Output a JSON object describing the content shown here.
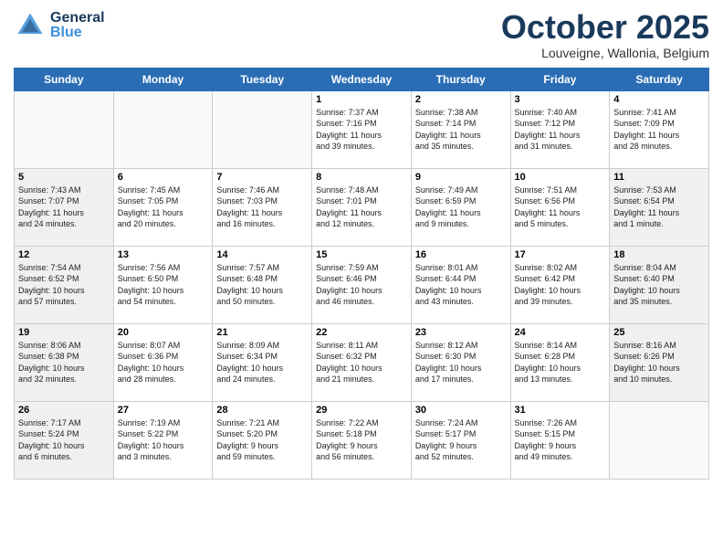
{
  "header": {
    "logo_general": "General",
    "logo_blue": "Blue",
    "month_title": "October 2025",
    "location": "Louveigne, Wallonia, Belgium"
  },
  "weekdays": [
    "Sunday",
    "Monday",
    "Tuesday",
    "Wednesday",
    "Thursday",
    "Friday",
    "Saturday"
  ],
  "weeks": [
    [
      {
        "day": "",
        "info": "",
        "empty": true
      },
      {
        "day": "",
        "info": "",
        "empty": true
      },
      {
        "day": "",
        "info": "",
        "empty": true
      },
      {
        "day": "1",
        "info": "Sunrise: 7:37 AM\nSunset: 7:16 PM\nDaylight: 11 hours\nand 39 minutes."
      },
      {
        "day": "2",
        "info": "Sunrise: 7:38 AM\nSunset: 7:14 PM\nDaylight: 11 hours\nand 35 minutes."
      },
      {
        "day": "3",
        "info": "Sunrise: 7:40 AM\nSunset: 7:12 PM\nDaylight: 11 hours\nand 31 minutes."
      },
      {
        "day": "4",
        "info": "Sunrise: 7:41 AM\nSunset: 7:09 PM\nDaylight: 11 hours\nand 28 minutes."
      }
    ],
    [
      {
        "day": "5",
        "info": "Sunrise: 7:43 AM\nSunset: 7:07 PM\nDaylight: 11 hours\nand 24 minutes.",
        "shaded": true
      },
      {
        "day": "6",
        "info": "Sunrise: 7:45 AM\nSunset: 7:05 PM\nDaylight: 11 hours\nand 20 minutes."
      },
      {
        "day": "7",
        "info": "Sunrise: 7:46 AM\nSunset: 7:03 PM\nDaylight: 11 hours\nand 16 minutes."
      },
      {
        "day": "8",
        "info": "Sunrise: 7:48 AM\nSunset: 7:01 PM\nDaylight: 11 hours\nand 12 minutes."
      },
      {
        "day": "9",
        "info": "Sunrise: 7:49 AM\nSunset: 6:59 PM\nDaylight: 11 hours\nand 9 minutes."
      },
      {
        "day": "10",
        "info": "Sunrise: 7:51 AM\nSunset: 6:56 PM\nDaylight: 11 hours\nand 5 minutes."
      },
      {
        "day": "11",
        "info": "Sunrise: 7:53 AM\nSunset: 6:54 PM\nDaylight: 11 hours\nand 1 minute.",
        "shaded": true
      }
    ],
    [
      {
        "day": "12",
        "info": "Sunrise: 7:54 AM\nSunset: 6:52 PM\nDaylight: 10 hours\nand 57 minutes.",
        "shaded": true
      },
      {
        "day": "13",
        "info": "Sunrise: 7:56 AM\nSunset: 6:50 PM\nDaylight: 10 hours\nand 54 minutes."
      },
      {
        "day": "14",
        "info": "Sunrise: 7:57 AM\nSunset: 6:48 PM\nDaylight: 10 hours\nand 50 minutes."
      },
      {
        "day": "15",
        "info": "Sunrise: 7:59 AM\nSunset: 6:46 PM\nDaylight: 10 hours\nand 46 minutes."
      },
      {
        "day": "16",
        "info": "Sunrise: 8:01 AM\nSunset: 6:44 PM\nDaylight: 10 hours\nand 43 minutes."
      },
      {
        "day": "17",
        "info": "Sunrise: 8:02 AM\nSunset: 6:42 PM\nDaylight: 10 hours\nand 39 minutes."
      },
      {
        "day": "18",
        "info": "Sunrise: 8:04 AM\nSunset: 6:40 PM\nDaylight: 10 hours\nand 35 minutes.",
        "shaded": true
      }
    ],
    [
      {
        "day": "19",
        "info": "Sunrise: 8:06 AM\nSunset: 6:38 PM\nDaylight: 10 hours\nand 32 minutes.",
        "shaded": true
      },
      {
        "day": "20",
        "info": "Sunrise: 8:07 AM\nSunset: 6:36 PM\nDaylight: 10 hours\nand 28 minutes."
      },
      {
        "day": "21",
        "info": "Sunrise: 8:09 AM\nSunset: 6:34 PM\nDaylight: 10 hours\nand 24 minutes."
      },
      {
        "day": "22",
        "info": "Sunrise: 8:11 AM\nSunset: 6:32 PM\nDaylight: 10 hours\nand 21 minutes."
      },
      {
        "day": "23",
        "info": "Sunrise: 8:12 AM\nSunset: 6:30 PM\nDaylight: 10 hours\nand 17 minutes."
      },
      {
        "day": "24",
        "info": "Sunrise: 8:14 AM\nSunset: 6:28 PM\nDaylight: 10 hours\nand 13 minutes."
      },
      {
        "day": "25",
        "info": "Sunrise: 8:16 AM\nSunset: 6:26 PM\nDaylight: 10 hours\nand 10 minutes.",
        "shaded": true
      }
    ],
    [
      {
        "day": "26",
        "info": "Sunrise: 7:17 AM\nSunset: 5:24 PM\nDaylight: 10 hours\nand 6 minutes.",
        "shaded": true
      },
      {
        "day": "27",
        "info": "Sunrise: 7:19 AM\nSunset: 5:22 PM\nDaylight: 10 hours\nand 3 minutes."
      },
      {
        "day": "28",
        "info": "Sunrise: 7:21 AM\nSunset: 5:20 PM\nDaylight: 9 hours\nand 59 minutes."
      },
      {
        "day": "29",
        "info": "Sunrise: 7:22 AM\nSunset: 5:18 PM\nDaylight: 9 hours\nand 56 minutes."
      },
      {
        "day": "30",
        "info": "Sunrise: 7:24 AM\nSunset: 5:17 PM\nDaylight: 9 hours\nand 52 minutes."
      },
      {
        "day": "31",
        "info": "Sunrise: 7:26 AM\nSunset: 5:15 PM\nDaylight: 9 hours\nand 49 minutes."
      },
      {
        "day": "",
        "info": "",
        "empty": true
      }
    ]
  ]
}
